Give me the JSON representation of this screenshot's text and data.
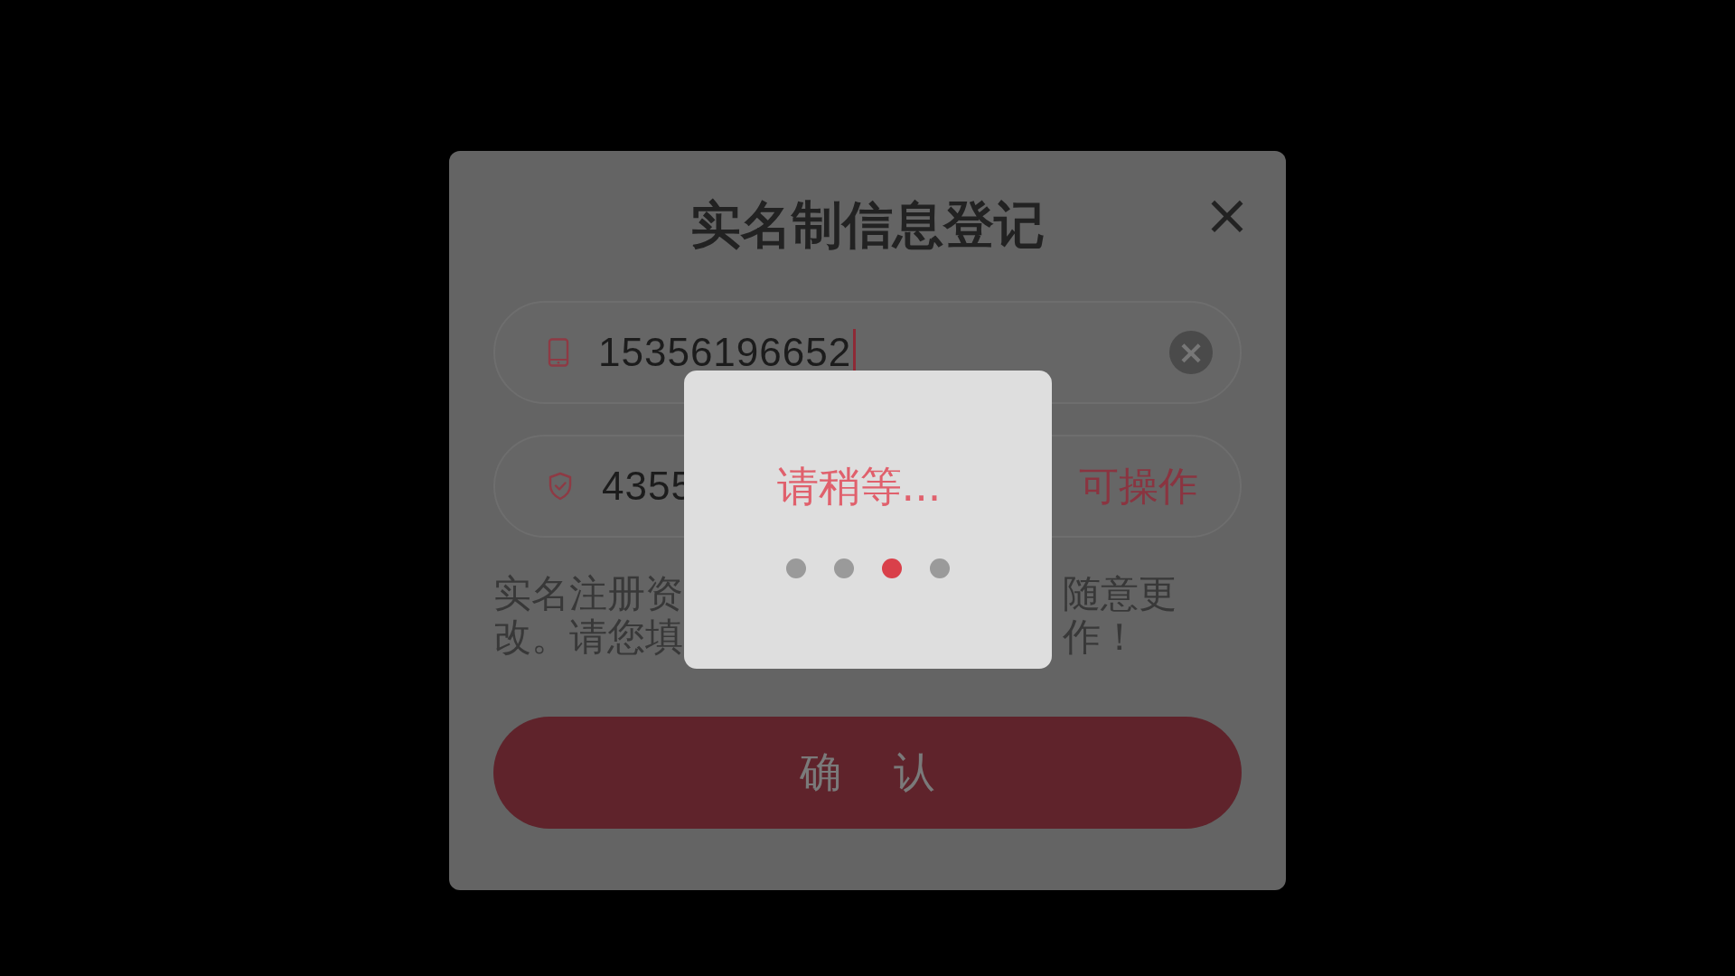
{
  "dialog": {
    "title": "实名制信息登记",
    "close": "×"
  },
  "phone_field": {
    "value": "15356196652",
    "focused": true,
    "clear": "×"
  },
  "code_field": {
    "value": "4355",
    "countdown": "可操作"
  },
  "notice": [
    {
      "left": "实名注册资",
      "right": "随意更"
    },
    {
      "left": "改。请您填",
      "right": "作！"
    }
  ],
  "confirm_button": {
    "label": "确 认",
    "disabled": true
  },
  "loading_toast": {
    "message": "请稍等...",
    "dots": [
      {
        "selected": false
      },
      {
        "selected": false
      },
      {
        "selected": true
      },
      {
        "selected": false
      }
    ]
  }
}
